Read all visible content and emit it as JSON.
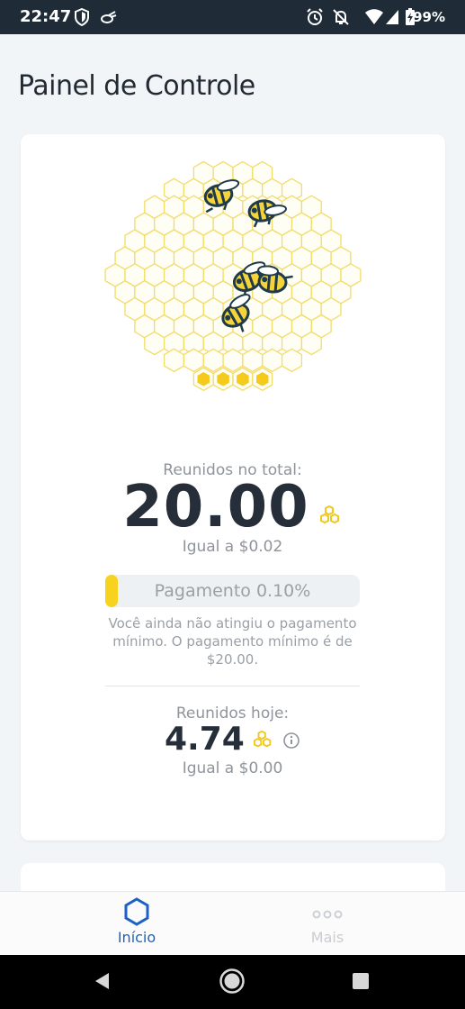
{
  "status_bar": {
    "time": "22:47",
    "battery": "99%"
  },
  "page": {
    "title": "Painel de Controle"
  },
  "summary": {
    "total_label": "Reunidos no total:",
    "total_value": "20.00",
    "total_equal": "Igual a $0.02",
    "payment_label": "Pagamento 0.10%",
    "payment_progress_percent": 0.1,
    "payment_note_line1": "Você ainda não atingiu o pagamento",
    "payment_note_line2": "mínimo. O pagamento mínimo é de",
    "payment_note_line3": "$20.00.",
    "today_label": "Reunidos hoje:",
    "today_value": "4.74",
    "today_equal": "Igual a $0.00"
  },
  "bottom_nav": {
    "items": [
      {
        "label": "Início",
        "icon": "hexagon-icon",
        "active": true
      },
      {
        "label": "Mais",
        "icon": "more-dots-icon",
        "active": false
      }
    ]
  },
  "colors": {
    "accent_blue": "#1b62c4",
    "honey_yellow": "#f7d21e",
    "hive_outline": "#f2dc6a"
  }
}
